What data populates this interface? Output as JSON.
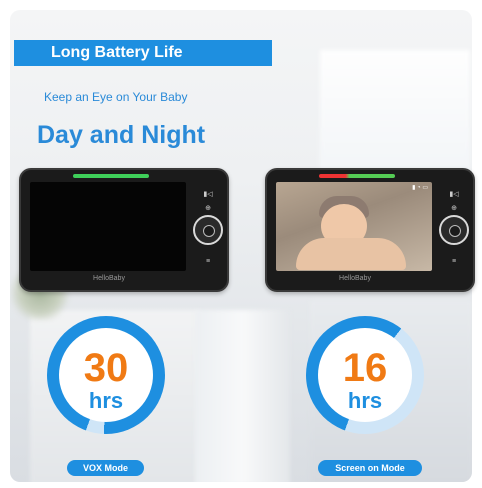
{
  "banner": {
    "title": "Long Battery Life",
    "color": "#1e8fe0"
  },
  "tagline": "Keep an Eye on Your Baby",
  "headline": "Day and Night",
  "monitors": [
    {
      "brand": "HelloBaby",
      "screen": "off"
    },
    {
      "brand": "HelloBaby",
      "screen": "baby-video"
    }
  ],
  "stats": [
    {
      "value": "30",
      "unit": "hrs",
      "mode": "VOX Mode",
      "ring_fill": 0.95
    },
    {
      "value": "16",
      "unit": "hrs",
      "mode": "Screen on Mode",
      "ring_fill": 0.55
    }
  ],
  "colors": {
    "accent": "#1e8fe0",
    "number": "#f07a14"
  }
}
